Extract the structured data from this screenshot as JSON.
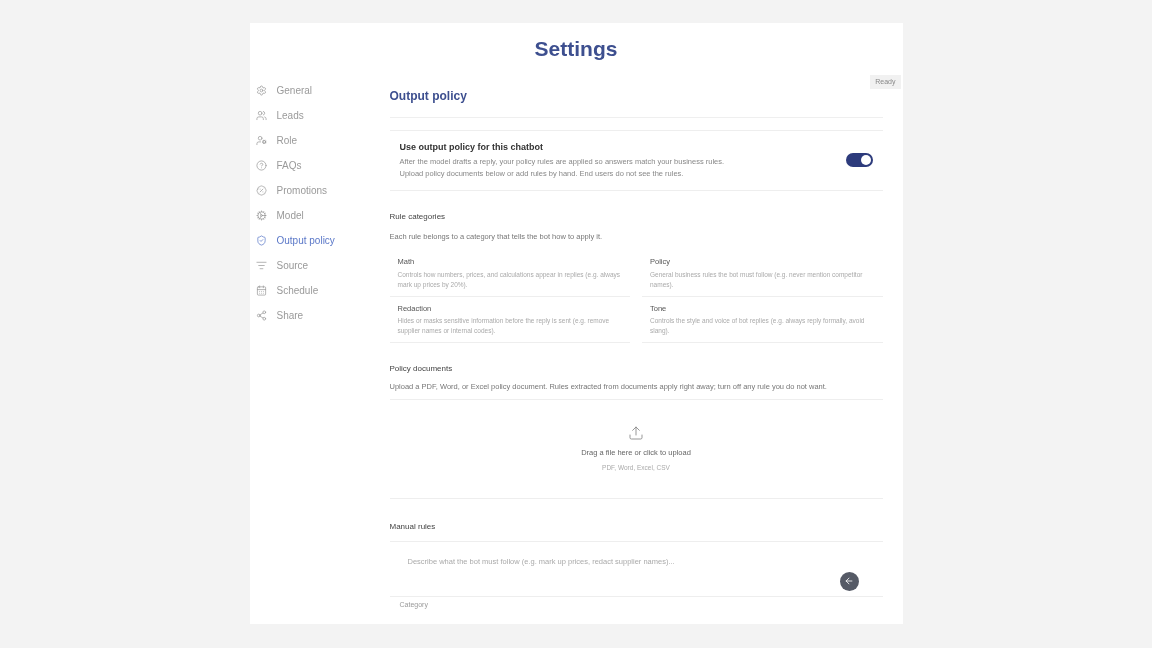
{
  "page_title": "Settings",
  "sidebar": {
    "items": [
      {
        "label": "General",
        "selected": false
      },
      {
        "label": "Leads",
        "selected": false
      },
      {
        "label": "Role",
        "selected": false
      },
      {
        "label": "FAQs",
        "selected": false
      },
      {
        "label": "Promotions",
        "selected": false
      },
      {
        "label": "Model",
        "selected": false
      },
      {
        "label": "Output policy",
        "selected": true
      },
      {
        "label": "Source",
        "selected": false
      },
      {
        "label": "Schedule",
        "selected": false
      },
      {
        "label": "Share",
        "selected": false
      }
    ]
  },
  "status_badge": "Ready",
  "section_title": "Output policy",
  "toggle_card": {
    "title": "Use output policy for this chatbot",
    "description": "After the model drafts a reply, your policy rules are applied so answers match your business rules. Upload policy documents below or add rules by hand. End users do not see the rules.",
    "on": true
  },
  "rule_categories": {
    "heading": "Rule categories",
    "intro": "Each rule belongs to a category that tells the bot how to apply it.",
    "items": [
      {
        "name": "Math",
        "description": "Controls how numbers, prices, and calculations appear in replies (e.g. always mark up prices by 20%)."
      },
      {
        "name": "Policy",
        "description": "General business rules the bot must follow (e.g. never mention competitor names)."
      },
      {
        "name": "Redaction",
        "description": "Hides or masks sensitive information before the reply is sent (e.g. remove supplier names or internal codes)."
      },
      {
        "name": "Tone",
        "description": "Controls the style and voice of bot replies (e.g. always reply formally, avoid slang)."
      }
    ]
  },
  "policy_documents": {
    "heading": "Policy documents",
    "intro": "Upload a PDF, Word, or Excel policy document. Rules extracted from documents apply right away; turn off any rule you do not want.",
    "dropzone_label": "Drag a file here or click to upload",
    "dropzone_formats": "PDF, Word, Excel, CSV"
  },
  "manual_rules": {
    "heading": "Manual rules",
    "placeholder": "Describe what the bot must follow (e.g. mark up prices, redact supplier names)...",
    "next_label": "Category"
  }
}
